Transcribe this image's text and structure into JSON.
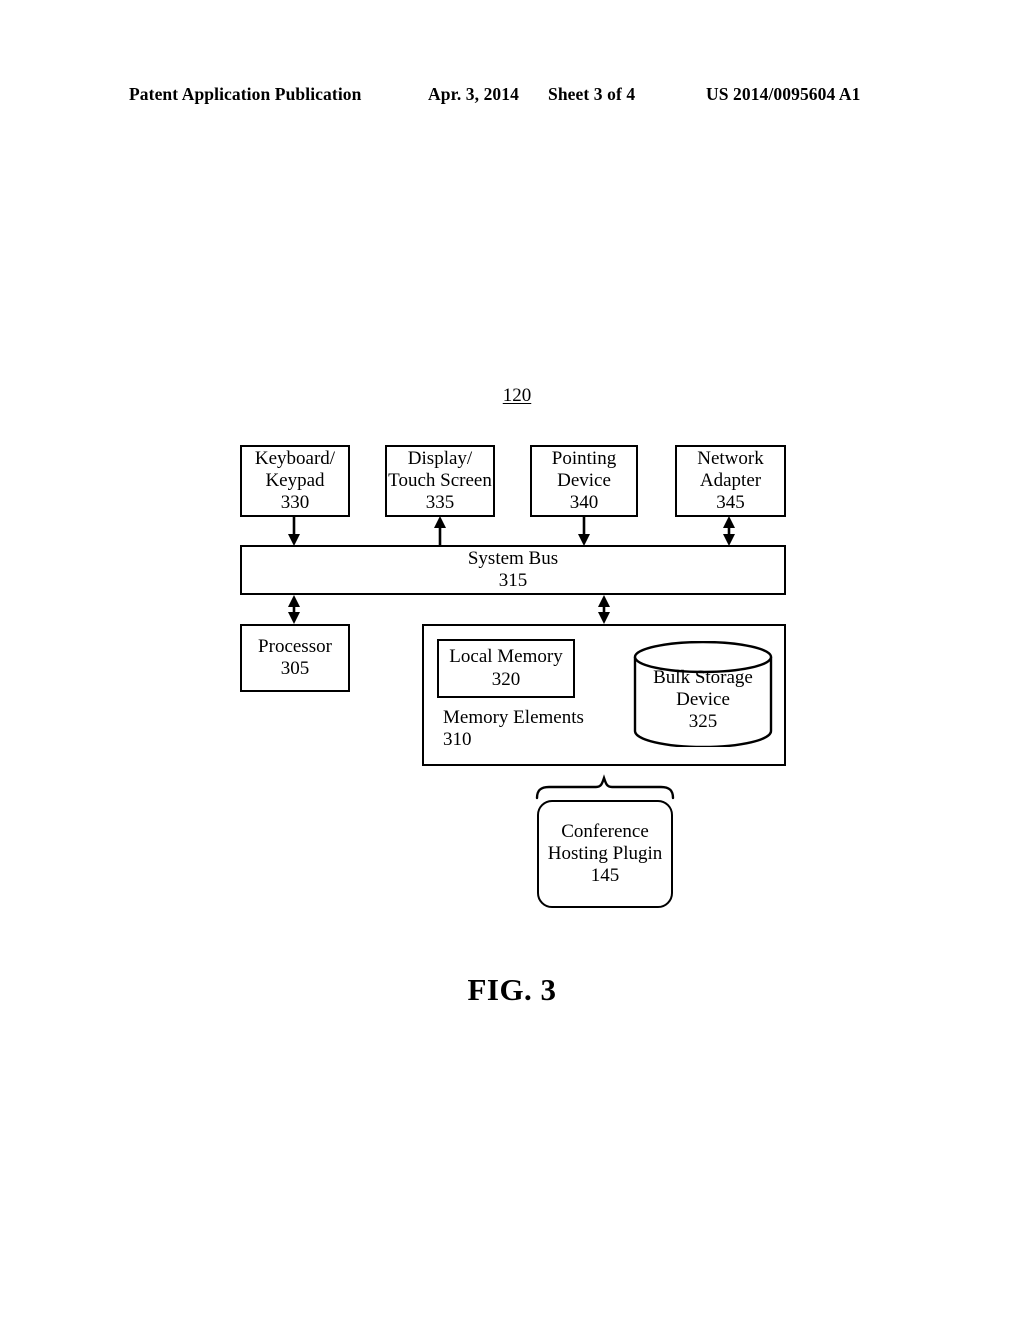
{
  "header": {
    "publication": "Patent Application Publication",
    "date": "Apr. 3, 2014",
    "sheet": "Sheet 3 of 4",
    "patent_number": "US 2014/0095604 A1"
  },
  "figure": {
    "caption": "FIG. 3",
    "system_reference": "120",
    "blocks": {
      "keyboard": {
        "line1": "Keyboard/",
        "line2": "Keypad",
        "ref": "330"
      },
      "display": {
        "line1": "Display/",
        "line2": "Touch Screen",
        "ref": "335"
      },
      "pointing": {
        "line1": "Pointing",
        "line2": "Device",
        "ref": "340"
      },
      "network": {
        "line1": "Network",
        "line2": "Adapter",
        "ref": "345"
      },
      "system_bus": {
        "line1": "System Bus",
        "ref": "315"
      },
      "processor": {
        "line1": "Processor",
        "ref": "305"
      },
      "local_memory": {
        "line1": "Local Memory",
        "ref": "320"
      },
      "memory_elements": {
        "line1": "Memory Elements",
        "ref": "310"
      },
      "bulk_storage": {
        "line1": "Bulk Storage",
        "line2": "Device",
        "ref": "325"
      },
      "conference_plugin": {
        "line1": "Conference",
        "line2": "Hosting Plugin",
        "ref": "145"
      }
    },
    "connections": [
      {
        "from": "keyboard",
        "to": "system_bus",
        "direction": "down"
      },
      {
        "from": "system_bus",
        "to": "display",
        "direction": "up"
      },
      {
        "from": "pointing",
        "to": "system_bus",
        "direction": "down"
      },
      {
        "from": "network",
        "to": "system_bus",
        "direction": "bidirectional"
      },
      {
        "from": "system_bus",
        "to": "processor",
        "direction": "bidirectional"
      },
      {
        "from": "system_bus",
        "to": "memory_elements",
        "direction": "bidirectional"
      },
      {
        "from": "memory_elements",
        "to": "conference_plugin",
        "direction": "brace"
      }
    ]
  },
  "colors": {
    "ink": "#000000",
    "paper": "#ffffff"
  }
}
